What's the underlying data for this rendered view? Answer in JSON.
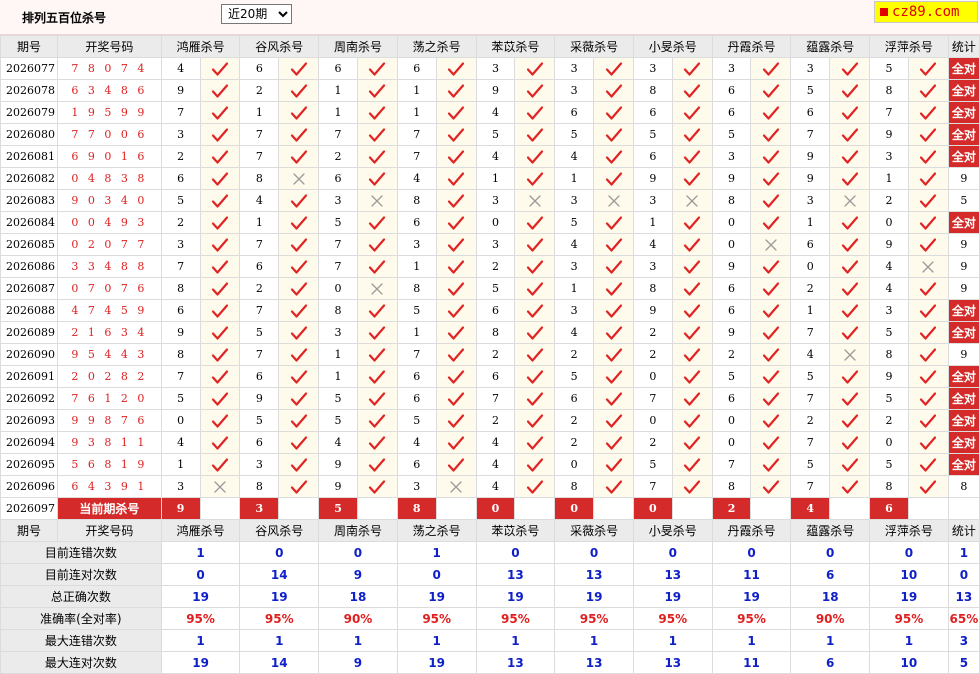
{
  "page_title": "排列五百位杀号",
  "range": {
    "selected": "近20期"
  },
  "logo": {
    "text": "cz89.com"
  },
  "headers": [
    "期号",
    "开奖号码",
    "鸿雁杀号",
    "谷风杀号",
    "周南杀号",
    "荡之杀号",
    "苯苡杀号",
    "采薇杀号",
    "小旻杀号",
    "丹霞杀号",
    "蕴露杀号",
    "浮萍杀号",
    "统计"
  ],
  "rows": [
    {
      "issue": "2026077",
      "draw": "7 8 0 7 4",
      "kills": [
        "4",
        "6",
        "6",
        "6",
        "3",
        "3",
        "3",
        "3",
        "3",
        "5"
      ],
      "marks": [
        "y",
        "y",
        "y",
        "y",
        "y",
        "y",
        "y",
        "y",
        "y",
        "y"
      ],
      "stat": "全对"
    },
    {
      "issue": "2026078",
      "draw": "6 3 4 8 6",
      "kills": [
        "9",
        "2",
        "1",
        "1",
        "9",
        "3",
        "8",
        "6",
        "5",
        "8"
      ],
      "marks": [
        "y",
        "y",
        "y",
        "y",
        "y",
        "y",
        "y",
        "y",
        "y",
        "y"
      ],
      "stat": "全对"
    },
    {
      "issue": "2026079",
      "draw": "1 9 5 9 9",
      "kills": [
        "7",
        "1",
        "1",
        "1",
        "4",
        "6",
        "6",
        "6",
        "6",
        "7"
      ],
      "marks": [
        "y",
        "y",
        "y",
        "y",
        "y",
        "y",
        "y",
        "y",
        "y",
        "y"
      ],
      "stat": "全对"
    },
    {
      "issue": "2026080",
      "draw": "7 7 0 0 6",
      "kills": [
        "3",
        "7",
        "7",
        "7",
        "5",
        "5",
        "5",
        "5",
        "7",
        "9"
      ],
      "marks": [
        "y",
        "y",
        "y",
        "y",
        "y",
        "y",
        "y",
        "y",
        "y",
        "y"
      ],
      "stat": "全对"
    },
    {
      "issue": "2026081",
      "draw": "6 9 0 1 6",
      "kills": [
        "2",
        "7",
        "2",
        "7",
        "4",
        "4",
        "6",
        "3",
        "9",
        "3"
      ],
      "marks": [
        "y",
        "y",
        "y",
        "y",
        "y",
        "y",
        "y",
        "y",
        "y",
        "y"
      ],
      "stat": "全对"
    },
    {
      "issue": "2026082",
      "draw": "0 4 8 3 8",
      "kills": [
        "6",
        "8",
        "6",
        "4",
        "1",
        "1",
        "9",
        "9",
        "9",
        "1"
      ],
      "marks": [
        "y",
        "n",
        "y",
        "y",
        "y",
        "y",
        "y",
        "y",
        "y",
        "y"
      ],
      "stat": "9"
    },
    {
      "issue": "2026083",
      "draw": "9 0 3 4 0",
      "kills": [
        "5",
        "4",
        "3",
        "8",
        "3",
        "3",
        "3",
        "8",
        "3",
        "2"
      ],
      "marks": [
        "y",
        "y",
        "n",
        "y",
        "n",
        "n",
        "n",
        "y",
        "n",
        "y"
      ],
      "stat": "5"
    },
    {
      "issue": "2026084",
      "draw": "0 0 4 9 3",
      "kills": [
        "2",
        "1",
        "5",
        "6",
        "0",
        "5",
        "1",
        "0",
        "1",
        "0"
      ],
      "marks": [
        "y",
        "y",
        "y",
        "y",
        "y",
        "y",
        "y",
        "y",
        "y",
        "y"
      ],
      "stat": "全对"
    },
    {
      "issue": "2026085",
      "draw": "0 2 0 7 7",
      "kills": [
        "3",
        "7",
        "7",
        "3",
        "3",
        "4",
        "4",
        "0",
        "6",
        "9"
      ],
      "marks": [
        "y",
        "y",
        "y",
        "y",
        "y",
        "y",
        "y",
        "n",
        "y",
        "y"
      ],
      "stat": "9"
    },
    {
      "issue": "2026086",
      "draw": "3 3 4 8 8",
      "kills": [
        "7",
        "6",
        "7",
        "1",
        "2",
        "3",
        "3",
        "9",
        "0",
        "4"
      ],
      "marks": [
        "y",
        "y",
        "y",
        "y",
        "y",
        "y",
        "y",
        "y",
        "y",
        "n"
      ],
      "stat": "9"
    },
    {
      "issue": "2026087",
      "draw": "0 7 0 7 6",
      "kills": [
        "8",
        "2",
        "0",
        "8",
        "5",
        "1",
        "8",
        "6",
        "2",
        "4"
      ],
      "marks": [
        "y",
        "y",
        "n",
        "y",
        "y",
        "y",
        "y",
        "y",
        "y",
        "y"
      ],
      "stat": "9"
    },
    {
      "issue": "2026088",
      "draw": "4 7 4 5 9",
      "kills": [
        "6",
        "7",
        "8",
        "5",
        "6",
        "3",
        "9",
        "6",
        "1",
        "3"
      ],
      "marks": [
        "y",
        "y",
        "y",
        "y",
        "y",
        "y",
        "y",
        "y",
        "y",
        "y"
      ],
      "stat": "全对"
    },
    {
      "issue": "2026089",
      "draw": "2 1 6 3 4",
      "kills": [
        "9",
        "5",
        "3",
        "1",
        "8",
        "4",
        "2",
        "9",
        "7",
        "5"
      ],
      "marks": [
        "y",
        "y",
        "y",
        "y",
        "y",
        "y",
        "y",
        "y",
        "y",
        "y"
      ],
      "stat": "全对"
    },
    {
      "issue": "2026090",
      "draw": "9 5 4 4 3",
      "kills": [
        "8",
        "7",
        "1",
        "7",
        "2",
        "2",
        "2",
        "2",
        "4",
        "8"
      ],
      "marks": [
        "y",
        "y",
        "y",
        "y",
        "y",
        "y",
        "y",
        "y",
        "n",
        "y"
      ],
      "stat": "9"
    },
    {
      "issue": "2026091",
      "draw": "2 0 2 8 2",
      "kills": [
        "7",
        "6",
        "1",
        "6",
        "6",
        "5",
        "0",
        "5",
        "5",
        "9"
      ],
      "marks": [
        "y",
        "y",
        "y",
        "y",
        "y",
        "y",
        "y",
        "y",
        "y",
        "y"
      ],
      "stat": "全对"
    },
    {
      "issue": "2026092",
      "draw": "7 6 1 2 0",
      "kills": [
        "5",
        "9",
        "5",
        "6",
        "7",
        "6",
        "7",
        "6",
        "7",
        "5"
      ],
      "marks": [
        "y",
        "y",
        "y",
        "y",
        "y",
        "y",
        "y",
        "y",
        "y",
        "y"
      ],
      "stat": "全对"
    },
    {
      "issue": "2026093",
      "draw": "9 9 8 7 6",
      "kills": [
        "0",
        "5",
        "5",
        "5",
        "2",
        "2",
        "0",
        "0",
        "2",
        "2"
      ],
      "marks": [
        "y",
        "y",
        "y",
        "y",
        "y",
        "y",
        "y",
        "y",
        "y",
        "y"
      ],
      "stat": "全对"
    },
    {
      "issue": "2026094",
      "draw": "9 3 8 1 1",
      "kills": [
        "4",
        "6",
        "4",
        "4",
        "4",
        "2",
        "2",
        "0",
        "7",
        "0"
      ],
      "marks": [
        "y",
        "y",
        "y",
        "y",
        "y",
        "y",
        "y",
        "y",
        "y",
        "y"
      ],
      "stat": "全对"
    },
    {
      "issue": "2026095",
      "draw": "5 6 8 1 9",
      "kills": [
        "1",
        "3",
        "9",
        "6",
        "4",
        "0",
        "5",
        "7",
        "5",
        "5"
      ],
      "marks": [
        "y",
        "y",
        "y",
        "y",
        "y",
        "y",
        "y",
        "y",
        "y",
        "y"
      ],
      "stat": "全对"
    },
    {
      "issue": "2026096",
      "draw": "6 4 3 9 1",
      "kills": [
        "3",
        "8",
        "9",
        "3",
        "4",
        "8",
        "7",
        "8",
        "7",
        "8"
      ],
      "marks": [
        "n",
        "y",
        "y",
        "n",
        "y",
        "y",
        "y",
        "y",
        "y",
        "y"
      ],
      "stat": "8"
    }
  ],
  "current": {
    "issue": "2026097",
    "label": "当前期杀号",
    "kills": [
      "9",
      "3",
      "5",
      "8",
      "0",
      "0",
      "0",
      "2",
      "4",
      "6"
    ]
  },
  "stats": {
    "headers": [
      "期号",
      "开奖号码",
      "鸿雁杀号",
      "谷风杀号",
      "周南杀号",
      "荡之杀号",
      "苯苡杀号",
      "采薇杀号",
      "小旻杀号",
      "丹霞杀号",
      "蕴露杀号",
      "浮萍杀号",
      "统计"
    ],
    "rows": [
      {
        "label": "目前连错次数",
        "values": [
          "1",
          "0",
          "0",
          "1",
          "0",
          "0",
          "0",
          "0",
          "0",
          "0",
          "1"
        ],
        "red": false
      },
      {
        "label": "目前连对次数",
        "values": [
          "0",
          "14",
          "9",
          "0",
          "13",
          "13",
          "13",
          "11",
          "6",
          "10",
          "0"
        ],
        "red": false
      },
      {
        "label": "总正确次数",
        "values": [
          "19",
          "19",
          "18",
          "19",
          "19",
          "19",
          "19",
          "19",
          "18",
          "19",
          "13"
        ],
        "red": false
      },
      {
        "label": "准确率(全对率)",
        "values": [
          "95%",
          "95%",
          "90%",
          "95%",
          "95%",
          "95%",
          "95%",
          "95%",
          "90%",
          "95%",
          "65%"
        ],
        "red": true
      },
      {
        "label": "最大连错次数",
        "values": [
          "1",
          "1",
          "1",
          "1",
          "1",
          "1",
          "1",
          "1",
          "1",
          "1",
          "3"
        ],
        "red": false
      },
      {
        "label": "最大连对次数",
        "values": [
          "19",
          "14",
          "9",
          "19",
          "13",
          "13",
          "13",
          "11",
          "6",
          "10",
          "5"
        ],
        "red": false
      }
    ]
  }
}
